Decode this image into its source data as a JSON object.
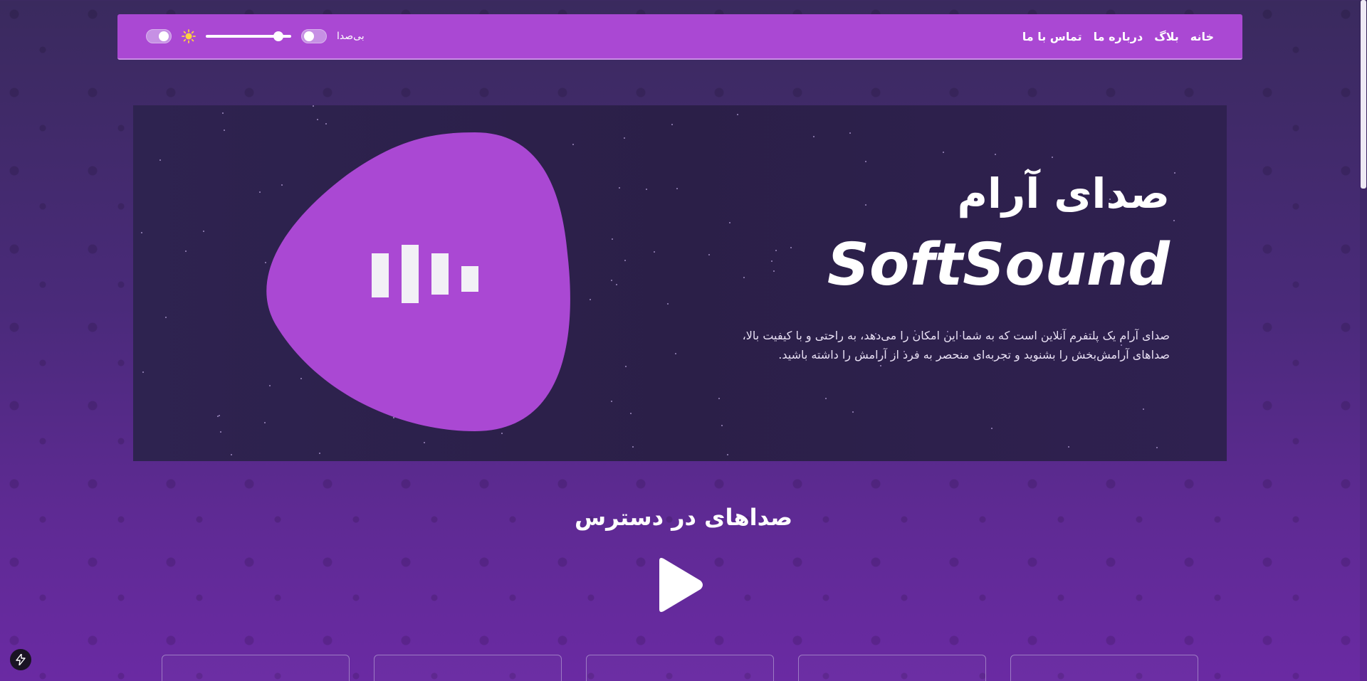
{
  "nav": {
    "links": [
      "خانه",
      "بلاگ",
      "درباره ما",
      "تماس با ما"
    ],
    "mute_label": "بی‌صدا",
    "volume": 0.85
  },
  "hero": {
    "title_fa": "صدای آرام",
    "title_en": "SoftSound",
    "description_line1": "صدای آرام یک پلتفرم آنلاین است که به شما این امکان را می‌دهد، به راحتی و با کیفیت بالا،",
    "description_line2": "صداهای آرامش‌بخش را بشنوید و تجربه‌ای منحصر به فرد از آرامش را داشته باشید."
  },
  "sounds_section": {
    "title": "صداهای در دسترس"
  },
  "colors": {
    "accent": "#aa48d3",
    "hero_bg": "#2e2350"
  },
  "icons": [
    "sun-icon",
    "play-icon",
    "sound-bars-icon",
    "lightning-icon"
  ]
}
